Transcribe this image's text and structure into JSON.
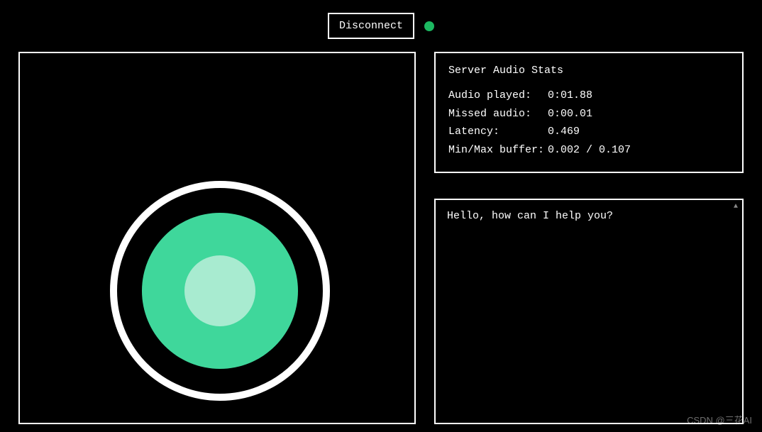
{
  "top": {
    "disconnect_label": "Disconnect",
    "status_color": "#1cb861"
  },
  "viz": {
    "outer_ring_color": "#ffffff",
    "mid_color": "#3fd79b",
    "inner_color": "#a8ebd0"
  },
  "stats": {
    "title": "Server Audio Stats",
    "rows": [
      {
        "label": "Audio played:",
        "value": "0:01.88"
      },
      {
        "label": "Missed audio:",
        "value": "0:00.01"
      },
      {
        "label": "Latency:",
        "value": "0.469"
      },
      {
        "label": "Min/Max buffer:",
        "value": "0.002 / 0.107"
      }
    ]
  },
  "chat": {
    "messages": [
      "Hello, how can I help you?"
    ]
  },
  "watermark": "CSDN @三花AI"
}
